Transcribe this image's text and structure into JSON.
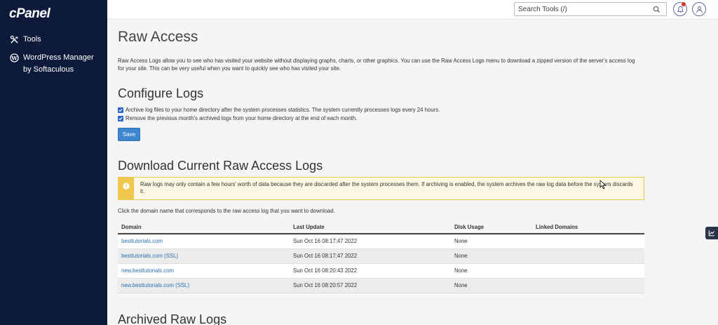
{
  "sidebar": {
    "logo": "cPanel",
    "items": [
      {
        "label": "Tools",
        "icon": "tools-icon"
      },
      {
        "label": "WordPress Manager by Softaculous",
        "icon": "wordpress-icon"
      }
    ]
  },
  "topbar": {
    "search_placeholder": "Search Tools (/)",
    "notifications_icon": "bell-icon",
    "user_icon": "user-icon"
  },
  "page": {
    "title": "Raw Access",
    "intro": "Raw Access Logs allow you to see who has visited your website without displaying graphs, charts, or other graphics. You can use the Raw Access Logs menu to download a zipped version of the server's access log for your site. This can be very useful when you want to quickly see who has visited your site."
  },
  "configure": {
    "title": "Configure Logs",
    "options": [
      {
        "label": "Archive log files to your home directory after the system processes statistics. The system currently processes logs every 24 hours.",
        "checked": true
      },
      {
        "label": "Remove the previous month's archived logs from your home directory at the end of each month.",
        "checked": true
      }
    ],
    "save_label": "Save"
  },
  "download": {
    "title": "Download Current Raw Access Logs",
    "warning": "Raw logs may only contain a few hours' worth of data because they are discarded after the system processes them. If archiving is enabled, the system archives the raw log data before the system discards it.",
    "help": "Click the domain name that corresponds to the raw access log that you want to download.",
    "table": {
      "headers": [
        "Domain",
        "Last Update",
        "Disk Usage",
        "Linked Domains"
      ],
      "rows": [
        {
          "domain": "besttutorials.com",
          "last_update": "Sun Oct 16 08:17:47 2022",
          "disk_usage": "None",
          "linked": ""
        },
        {
          "domain": "besttutorials.com (SSL)",
          "last_update": "Sun Oct 16 08:17:47 2022",
          "disk_usage": "None",
          "linked": ""
        },
        {
          "domain": "new.besttutorials.com",
          "last_update": "Sun Oct 16 08:20:43 2022",
          "disk_usage": "None",
          "linked": ""
        },
        {
          "domain": "new.besttutorials.com (SSL)",
          "last_update": "Sun Oct 16 08:20:57 2022",
          "disk_usage": "None",
          "linked": ""
        }
      ]
    }
  },
  "archived": {
    "title": "Archived Raw Logs"
  },
  "colors": {
    "sidebar_bg": "#0d1a3a",
    "accent": "#3e87cf",
    "link": "#2a6fb3",
    "warning_border": "#f0c74d",
    "warning_bg": "#fcf8e3"
  }
}
